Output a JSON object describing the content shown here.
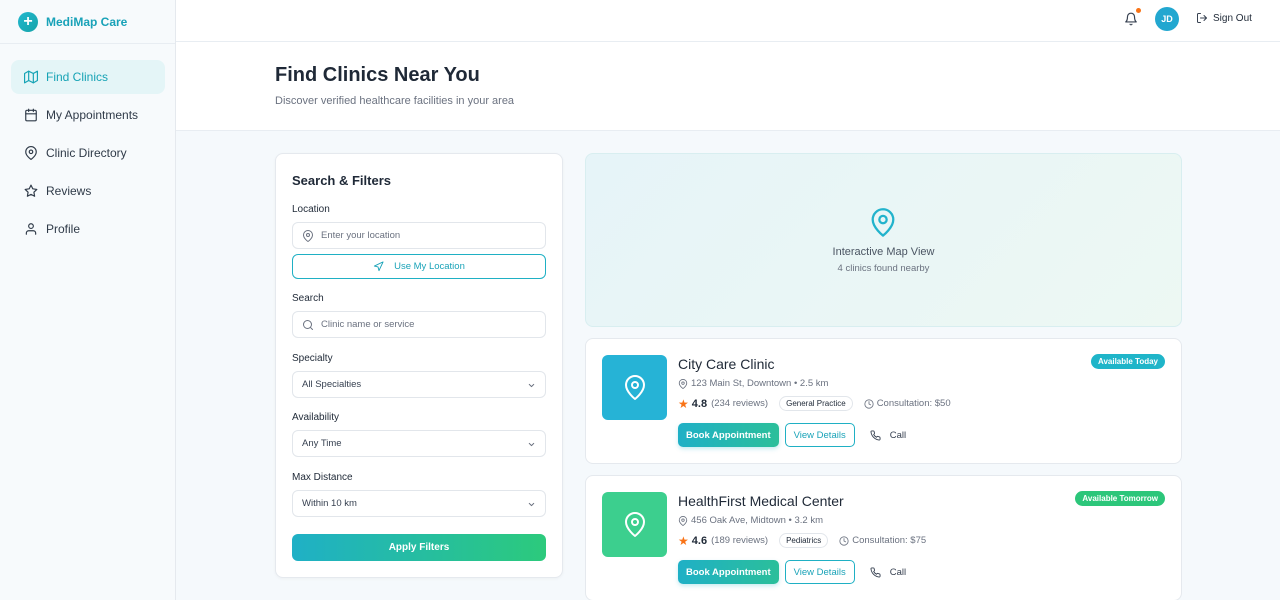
{
  "brand": {
    "name": "MediMap Care"
  },
  "sidebar": {
    "items": [
      {
        "label": "Find Clinics",
        "icon": "map-icon",
        "active": true
      },
      {
        "label": "My Appointments",
        "icon": "calendar-icon"
      },
      {
        "label": "Clinic Directory",
        "icon": "map-pin-icon"
      },
      {
        "label": "Reviews",
        "icon": "star-icon"
      },
      {
        "label": "Profile",
        "icon": "user-icon"
      }
    ]
  },
  "topbar": {
    "avatar_initials": "JD",
    "signout_label": "Sign Out",
    "notification_dot": true
  },
  "header": {
    "title": "Find Clinics Near You",
    "subtitle": "Discover verified healthcare facilities in your area"
  },
  "filters": {
    "title": "Search & Filters",
    "location_label": "Location",
    "location_placeholder": "Enter your location",
    "use_location_label": "Use My Location",
    "search_label": "Search",
    "search_placeholder": "Clinic name or service",
    "specialty_label": "Specialty",
    "specialty_value": "All Specialties",
    "availability_label": "Availability",
    "availability_value": "Any Time",
    "distance_label": "Max Distance",
    "distance_value": "Within 10 km",
    "apply_label": "Apply Filters"
  },
  "map": {
    "title": "Interactive Map View",
    "subtitle": "4 clinics found nearby"
  },
  "clinics": [
    {
      "name": "City Care Clinic",
      "address": "123 Main St, Downtown • 2.5 km",
      "rating": "4.8",
      "reviews": "(234 reviews)",
      "specialty": "General Practice",
      "consultation": "Consultation: $50",
      "badge": "Available Today",
      "badge_color": "#1fb5c9",
      "thumb_color": "#26b3d6",
      "book_label": "Book Appointment",
      "view_label": "View Details",
      "call_label": "Call"
    },
    {
      "name": "HealthFirst Medical Center",
      "address": "456 Oak Ave, Midtown • 3.2 km",
      "rating": "4.6",
      "reviews": "(189 reviews)",
      "specialty": "Pediatrics",
      "consultation": "Consultation: $75",
      "badge": "Available Tomorrow",
      "badge_color": "#2cc67a",
      "thumb_color": "#3ccf8e",
      "book_label": "Book Appointment",
      "view_label": "View Details",
      "call_label": "Call"
    }
  ]
}
